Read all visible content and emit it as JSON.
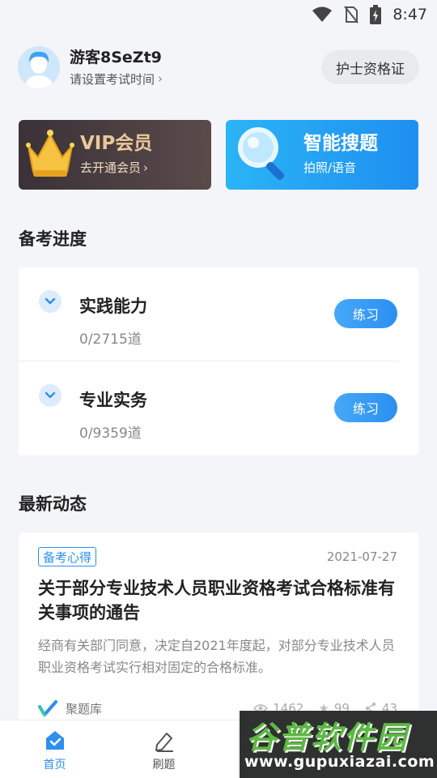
{
  "status_bar": {
    "time": "8:47"
  },
  "profile": {
    "username": "游客8SeZt9",
    "set_time_label": "请设置考试时间",
    "cert_button": "护士资格证"
  },
  "promos": {
    "vip": {
      "title": "VIP会员",
      "subtitle": "去开通会员"
    },
    "search": {
      "title": "智能搜题",
      "subtitle": "拍照/语音"
    }
  },
  "progress": {
    "section_title": "备考进度",
    "subjects": [
      {
        "name": "实践能力",
        "count": "0/2715道",
        "button": "练习"
      },
      {
        "name": "专业实务",
        "count": "0/9359道",
        "button": "练习"
      }
    ]
  },
  "news": {
    "section_title": "最新动态",
    "item": {
      "tag": "备考心得",
      "date": "2021-07-27",
      "title": "关于部分专业技术人员职业资格考试合格标准有关事项的通告",
      "excerpt": "经商有关部门同意，决定自2021年度起，对部分专业技术人员职业资格考试实行相对固定的合格标准。",
      "source": "聚题库",
      "views": "1462",
      "likes": "99",
      "shares": "43"
    }
  },
  "tabbar": {
    "tabs": [
      {
        "label": "首页",
        "active": true
      },
      {
        "label": "刷题",
        "active": false
      },
      {
        "label": "",
        "active": false
      },
      {
        "label": "",
        "active": false
      }
    ]
  },
  "watermark": {
    "title": "谷普软件园",
    "url": "www.gupuxiazai.com"
  },
  "colors": {
    "accent": "#2c8ff2",
    "vip_gold": "#e9c89a",
    "background": "#f4f5f8"
  }
}
